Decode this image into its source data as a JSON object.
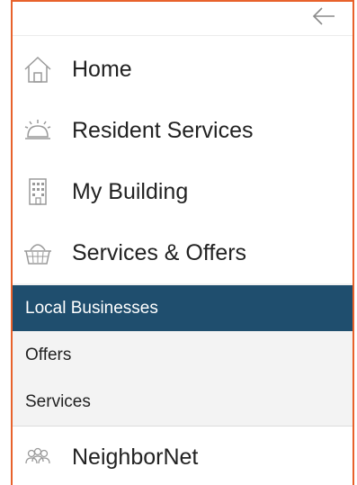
{
  "colors": {
    "frame_border": "#e8622c",
    "active_bg": "#1f4e6e",
    "active_text": "#ffffff",
    "submenu_bg": "#f3f3f3",
    "icon_stroke": "#9a9a9a"
  },
  "topbar": {
    "back_icon": "arrow-left-icon"
  },
  "nav": {
    "items": [
      {
        "label": "Home",
        "icon": "house-icon"
      },
      {
        "label": "Resident Services",
        "icon": "service-bell-icon"
      },
      {
        "label": "My Building",
        "icon": "building-icon"
      },
      {
        "label": "Services & Offers",
        "icon": "basket-icon"
      },
      {
        "label": "NeighborNet",
        "icon": "people-icon"
      }
    ]
  },
  "submenu": {
    "items": [
      {
        "label": "Local Businesses",
        "active": true
      },
      {
        "label": "Offers",
        "active": false
      },
      {
        "label": "Services",
        "active": false
      }
    ]
  }
}
